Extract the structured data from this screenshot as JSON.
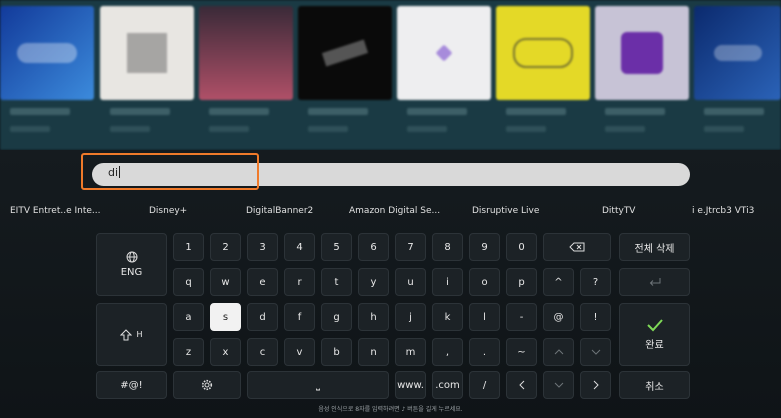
{
  "search": {
    "query": "di"
  },
  "suggestions": [
    "EITV Entret..e Inte...",
    "Disney+",
    "DigitalBanner2",
    "Amazon Digital Se...",
    "Disruptive Live",
    "DittyTV",
    "i e.Jtrcb3 VTi3"
  ],
  "keyboard": {
    "row1": [
      "1",
      "2",
      "3",
      "4",
      "5",
      "6",
      "7",
      "8",
      "9",
      "0"
    ],
    "row2": [
      "q",
      "w",
      "e",
      "r",
      "t",
      "y",
      "u",
      "i",
      "o",
      "p",
      "^",
      "?"
    ],
    "row3": [
      "a",
      "s",
      "d",
      "f",
      "g",
      "h",
      "j",
      "k",
      "l",
      "-",
      "@",
      "!"
    ],
    "row4": [
      "z",
      "x",
      "c",
      "v",
      "b",
      "n",
      "m",
      ",",
      ".",
      "~"
    ],
    "language_label": "ENG",
    "shift_label": "H",
    "clear_all_label": "전체 삭제",
    "done_label": "완료",
    "symbols_label": "#@!",
    "space_label": "⎵",
    "www_label": "www.",
    "com_label": ".com",
    "slash_label": "/",
    "cancel_label": "취소",
    "selected_key": "s"
  },
  "hint_text": "음성 인식으로 8자를 입력하려면 ♪ 버튼을 길게 누르세요.",
  "colors": {
    "focus": "#f07a2a",
    "search_bg": "#d9d9d9",
    "key_bg": "#1c2226",
    "selected_key_bg": "#f2f2f2",
    "done_check": "#7ed957"
  }
}
